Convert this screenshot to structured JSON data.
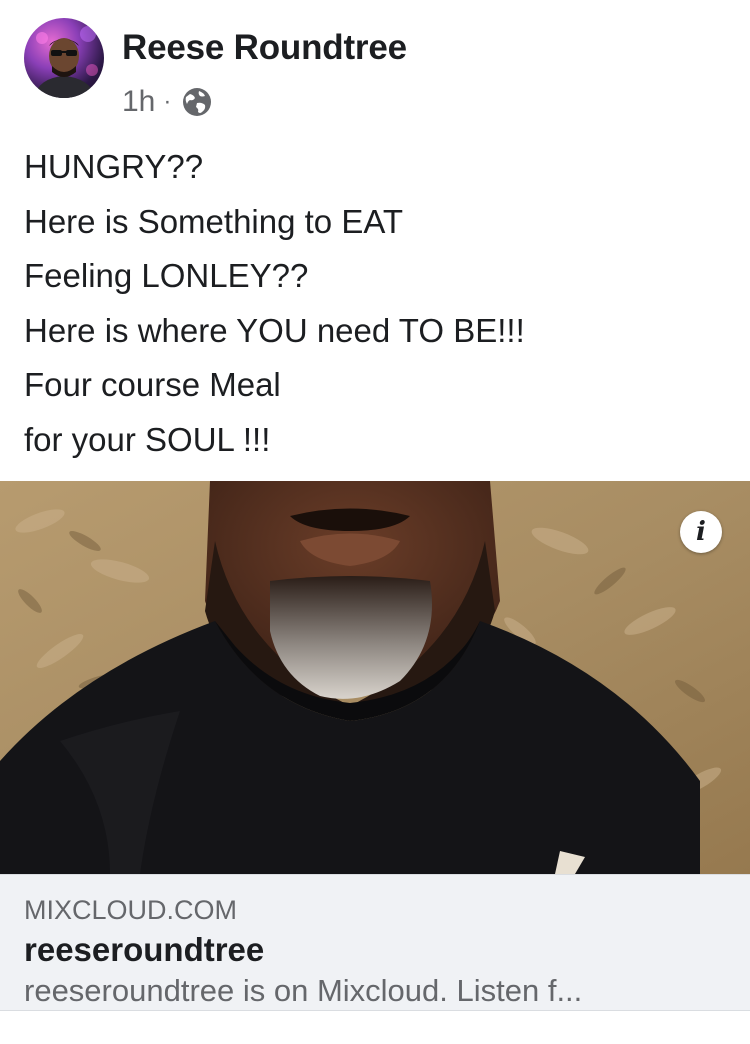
{
  "post": {
    "author": "Reese Roundtree",
    "time": "1h",
    "separator": "·",
    "privacy_icon": "globe-icon",
    "text_lines": [
      "HUNGRY??",
      "Here is Something to EAT",
      "Feeling LONLEY??",
      "Here is where YOU need TO BE!!!",
      "Four course Meal",
      "for your SOUL !!!"
    ]
  },
  "link": {
    "info_icon": "info-icon",
    "info_label": "i",
    "domain": "MIXCLOUD.COM",
    "title": "reeseroundtree",
    "description": "reeseroundtree is on Mixcloud. Listen f..."
  },
  "colors": {
    "text_primary": "#1c1e21",
    "text_secondary": "#65676b",
    "card_background": "#f0f2f5"
  }
}
